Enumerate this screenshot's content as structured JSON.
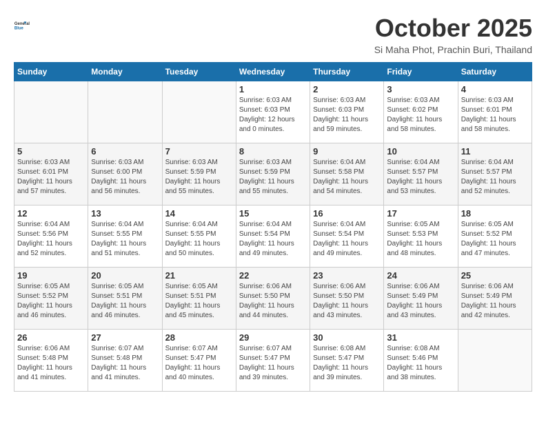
{
  "header": {
    "logo_line1": "General",
    "logo_line2": "Blue",
    "month": "October 2025",
    "location": "Si Maha Phot, Prachin Buri, Thailand"
  },
  "days_of_week": [
    "Sunday",
    "Monday",
    "Tuesday",
    "Wednesday",
    "Thursday",
    "Friday",
    "Saturday"
  ],
  "weeks": [
    [
      {
        "day": "",
        "info": ""
      },
      {
        "day": "",
        "info": ""
      },
      {
        "day": "",
        "info": ""
      },
      {
        "day": "1",
        "info": "Sunrise: 6:03 AM\nSunset: 6:03 PM\nDaylight: 12 hours\nand 0 minutes."
      },
      {
        "day": "2",
        "info": "Sunrise: 6:03 AM\nSunset: 6:03 PM\nDaylight: 11 hours\nand 59 minutes."
      },
      {
        "day": "3",
        "info": "Sunrise: 6:03 AM\nSunset: 6:02 PM\nDaylight: 11 hours\nand 58 minutes."
      },
      {
        "day": "4",
        "info": "Sunrise: 6:03 AM\nSunset: 6:01 PM\nDaylight: 11 hours\nand 58 minutes."
      }
    ],
    [
      {
        "day": "5",
        "info": "Sunrise: 6:03 AM\nSunset: 6:01 PM\nDaylight: 11 hours\nand 57 minutes."
      },
      {
        "day": "6",
        "info": "Sunrise: 6:03 AM\nSunset: 6:00 PM\nDaylight: 11 hours\nand 56 minutes."
      },
      {
        "day": "7",
        "info": "Sunrise: 6:03 AM\nSunset: 5:59 PM\nDaylight: 11 hours\nand 55 minutes."
      },
      {
        "day": "8",
        "info": "Sunrise: 6:03 AM\nSunset: 5:59 PM\nDaylight: 11 hours\nand 55 minutes."
      },
      {
        "day": "9",
        "info": "Sunrise: 6:04 AM\nSunset: 5:58 PM\nDaylight: 11 hours\nand 54 minutes."
      },
      {
        "day": "10",
        "info": "Sunrise: 6:04 AM\nSunset: 5:57 PM\nDaylight: 11 hours\nand 53 minutes."
      },
      {
        "day": "11",
        "info": "Sunrise: 6:04 AM\nSunset: 5:57 PM\nDaylight: 11 hours\nand 52 minutes."
      }
    ],
    [
      {
        "day": "12",
        "info": "Sunrise: 6:04 AM\nSunset: 5:56 PM\nDaylight: 11 hours\nand 52 minutes."
      },
      {
        "day": "13",
        "info": "Sunrise: 6:04 AM\nSunset: 5:55 PM\nDaylight: 11 hours\nand 51 minutes."
      },
      {
        "day": "14",
        "info": "Sunrise: 6:04 AM\nSunset: 5:55 PM\nDaylight: 11 hours\nand 50 minutes."
      },
      {
        "day": "15",
        "info": "Sunrise: 6:04 AM\nSunset: 5:54 PM\nDaylight: 11 hours\nand 49 minutes."
      },
      {
        "day": "16",
        "info": "Sunrise: 6:04 AM\nSunset: 5:54 PM\nDaylight: 11 hours\nand 49 minutes."
      },
      {
        "day": "17",
        "info": "Sunrise: 6:05 AM\nSunset: 5:53 PM\nDaylight: 11 hours\nand 48 minutes."
      },
      {
        "day": "18",
        "info": "Sunrise: 6:05 AM\nSunset: 5:52 PM\nDaylight: 11 hours\nand 47 minutes."
      }
    ],
    [
      {
        "day": "19",
        "info": "Sunrise: 6:05 AM\nSunset: 5:52 PM\nDaylight: 11 hours\nand 46 minutes."
      },
      {
        "day": "20",
        "info": "Sunrise: 6:05 AM\nSunset: 5:51 PM\nDaylight: 11 hours\nand 46 minutes."
      },
      {
        "day": "21",
        "info": "Sunrise: 6:05 AM\nSunset: 5:51 PM\nDaylight: 11 hours\nand 45 minutes."
      },
      {
        "day": "22",
        "info": "Sunrise: 6:06 AM\nSunset: 5:50 PM\nDaylight: 11 hours\nand 44 minutes."
      },
      {
        "day": "23",
        "info": "Sunrise: 6:06 AM\nSunset: 5:50 PM\nDaylight: 11 hours\nand 43 minutes."
      },
      {
        "day": "24",
        "info": "Sunrise: 6:06 AM\nSunset: 5:49 PM\nDaylight: 11 hours\nand 43 minutes."
      },
      {
        "day": "25",
        "info": "Sunrise: 6:06 AM\nSunset: 5:49 PM\nDaylight: 11 hours\nand 42 minutes."
      }
    ],
    [
      {
        "day": "26",
        "info": "Sunrise: 6:06 AM\nSunset: 5:48 PM\nDaylight: 11 hours\nand 41 minutes."
      },
      {
        "day": "27",
        "info": "Sunrise: 6:07 AM\nSunset: 5:48 PM\nDaylight: 11 hours\nand 41 minutes."
      },
      {
        "day": "28",
        "info": "Sunrise: 6:07 AM\nSunset: 5:47 PM\nDaylight: 11 hours\nand 40 minutes."
      },
      {
        "day": "29",
        "info": "Sunrise: 6:07 AM\nSunset: 5:47 PM\nDaylight: 11 hours\nand 39 minutes."
      },
      {
        "day": "30",
        "info": "Sunrise: 6:08 AM\nSunset: 5:47 PM\nDaylight: 11 hours\nand 39 minutes."
      },
      {
        "day": "31",
        "info": "Sunrise: 6:08 AM\nSunset: 5:46 PM\nDaylight: 11 hours\nand 38 minutes."
      },
      {
        "day": "",
        "info": ""
      }
    ]
  ]
}
